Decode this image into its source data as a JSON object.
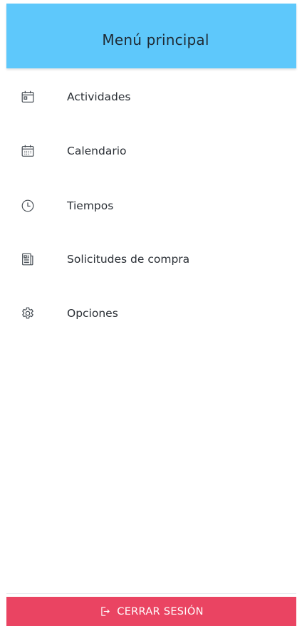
{
  "header": {
    "title": "Menú principal",
    "background_color": "#5ec8fb"
  },
  "menu": {
    "items": [
      {
        "label": "Actividades",
        "icon": "activity-calendar-icon"
      },
      {
        "label": "Calendario",
        "icon": "calendar-grid-icon"
      },
      {
        "label": "Tiempos",
        "icon": "clock-icon"
      },
      {
        "label": "Solicitudes de compra",
        "icon": "purchase-request-document-icon"
      },
      {
        "label": "Opciones",
        "icon": "gear-icon"
      }
    ]
  },
  "footer": {
    "logout_label": "CERRAR SESIÓN",
    "logout_icon": "logout-icon",
    "logout_color": "#ea4462"
  }
}
